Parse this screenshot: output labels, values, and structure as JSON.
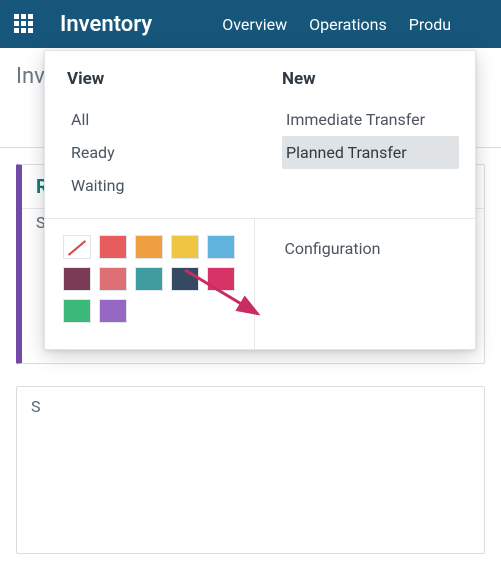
{
  "topbar": {
    "app_title": "Inventory",
    "nav": {
      "overview": "Overview",
      "operations": "Operations",
      "products": "Produ"
    }
  },
  "page": {
    "heading": "Inventory Overview"
  },
  "card1": {
    "title": "Receipts",
    "trunc": "S"
  },
  "card2": {
    "trunc": "S"
  },
  "popover": {
    "view_heading": "View",
    "view_items": {
      "all": "All",
      "ready": "Ready",
      "waiting": "Waiting"
    },
    "new_heading": "New",
    "new_items": {
      "immediate": "Immediate Transfer",
      "planned": "Planned Transfer"
    },
    "config": "Configuration",
    "swatch_colors": {
      "r1c2": "#e75c5c",
      "r1c3": "#ef9f42",
      "r1c4": "#eec643",
      "r1c5": "#5fb3dc",
      "r2c1": "#7b3a55",
      "r2c2": "#de6f75",
      "r2c3": "#3f9da0",
      "r2c4": "#344a63",
      "r2c5": "#d83367",
      "r3c1": "#3cb878",
      "r3c2": "#9668c4"
    }
  }
}
